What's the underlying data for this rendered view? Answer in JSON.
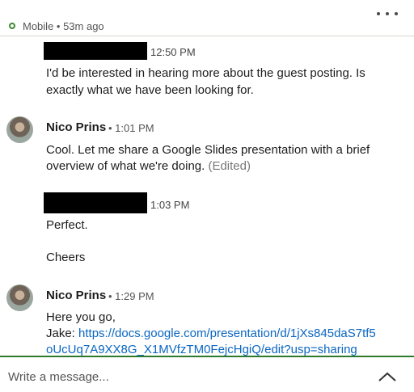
{
  "header": {
    "status_text": "Mobile • 53m ago",
    "status_color": "#3e8a2f"
  },
  "messages": [
    {
      "sender_redacted": true,
      "time": "12:50 PM",
      "lines": [
        "I'd be interested in hearing more about the guest posting. Is",
        "exactly what we have been looking for."
      ]
    },
    {
      "sender": "Nico Prins",
      "time": "• 1:01 PM",
      "lines": [
        "Cool. Let me share a Google Slides presentation with a brief",
        "overview of what we're doing."
      ],
      "edited": "(Edited)"
    },
    {
      "sender_redacted": true,
      "time": "1:03 PM",
      "lines": [
        "Perfect.",
        "Cheers"
      ]
    },
    {
      "sender": "Nico Prins",
      "time": "• 1:29 PM",
      "lines": [
        "Here you go,",
        "Jake:"
      ],
      "link_line1": "https://docs.google.com/presentation/d/1jXs845daS7tf5",
      "link_line2": "oUcUq7A9XX8G_X1MVfzTM0FejcHgiQ/edit?usp=sharing"
    }
  ],
  "composer": {
    "placeholder": "Write a message...",
    "border_color": "#2d7a2d"
  },
  "link_color": "#0a66c2"
}
